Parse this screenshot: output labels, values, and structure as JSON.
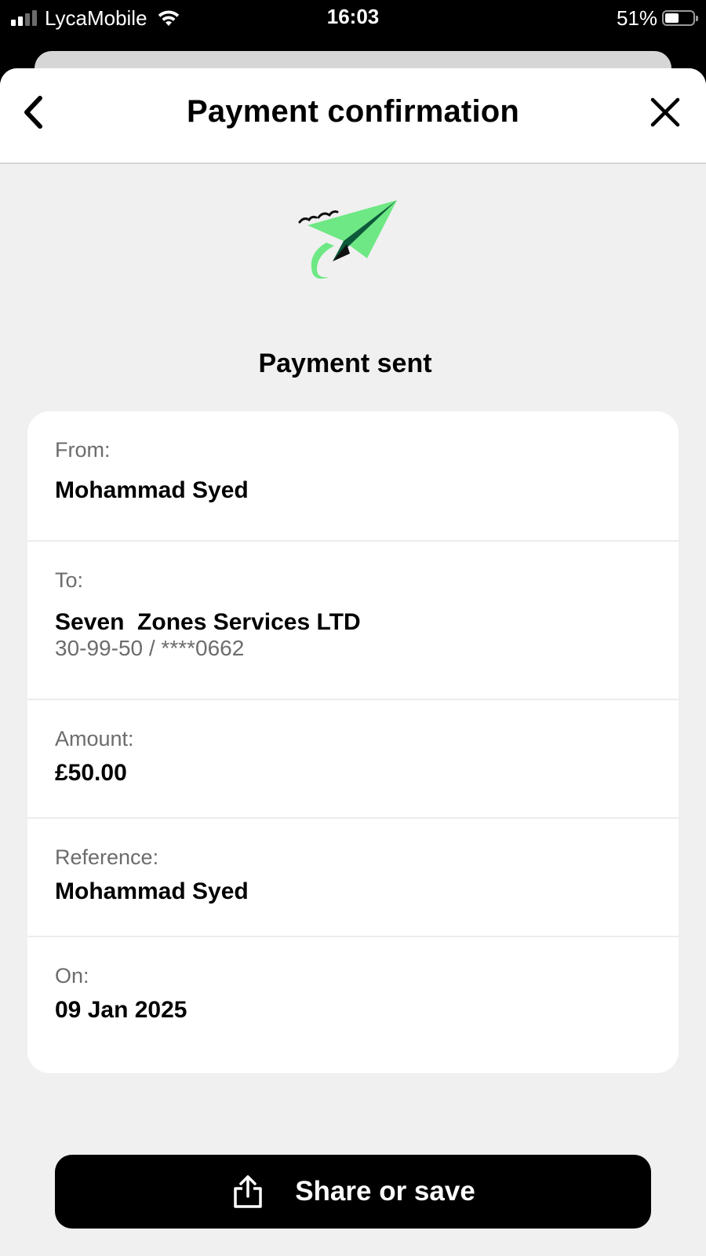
{
  "status_bar": {
    "carrier": "LycaMobile",
    "time": "16:03",
    "battery_percent": "51%",
    "battery_level": 0.51,
    "signal_bars_active": 2,
    "signal_bars_total": 4,
    "icons": [
      "cellular-signal-icon",
      "wifi-icon",
      "battery-icon"
    ]
  },
  "header": {
    "title": "Payment confirmation",
    "back_icon": "chevron-left-icon",
    "close_icon": "close-icon"
  },
  "illustration": {
    "icon": "paper-plane-icon",
    "colors": {
      "light_green": "#6ee884",
      "dark_green": "#0c5a3a",
      "ink": "#111111"
    }
  },
  "result": {
    "title": "Payment sent"
  },
  "details": {
    "from": {
      "label": "From:",
      "value": "Mohammad Syed"
    },
    "to": {
      "label": "To:",
      "value": "Seven  Zones Services LTD",
      "account": "30-99-50 / ****0662"
    },
    "amount": {
      "label": "Amount:",
      "value": "£50.00"
    },
    "reference": {
      "label": "Reference:",
      "value": "Mohammad Syed"
    },
    "on": {
      "label": "On:",
      "value": "09 Jan 2025"
    }
  },
  "actions": {
    "share_label": "Share or save",
    "share_icon": "share-icon"
  }
}
